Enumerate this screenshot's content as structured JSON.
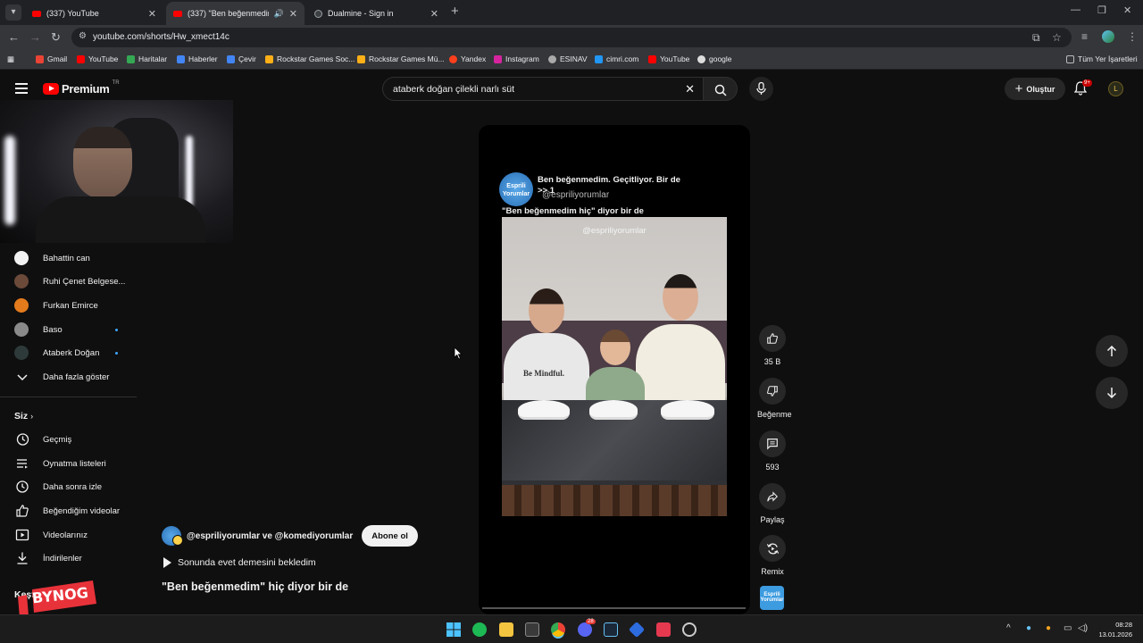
{
  "browser": {
    "tabs": [
      {
        "title": "(337) YouTube"
      },
      {
        "title": "(337) \"Ben beğenmedim\" hiç diyor bir de"
      },
      {
        "title": "Dualmine - Sign in"
      }
    ],
    "url": "youtube.com/shorts/Hw_xmect14c",
    "bookmarks": [
      "Gmail",
      "YouTube",
      "Haritalar",
      "Haberler",
      "Çevir",
      "Rockstar Games Soc...",
      "Rockstar Games Mü...",
      "Yandex",
      "Instagram",
      "ESINAV",
      "cimri.com",
      "YouTube",
      "google"
    ],
    "all_bookmarks": "Tüm Yer İşaretleri"
  },
  "header": {
    "logo": "Premium",
    "region": "TR",
    "search_query": "ataberk doğan çilekli narlı süt",
    "create_label": "Oluştur",
    "notif_count": "9+"
  },
  "sidebar": {
    "subscriptions": [
      {
        "name": "Bahattin can",
        "new": false
      },
      {
        "name": "Ruhi Çenet Belgese...",
        "new": false
      },
      {
        "name": "Furkan Emirce",
        "new": false
      },
      {
        "name": "Baso",
        "new": true
      },
      {
        "name": "Ataberk Doğan",
        "new": true
      }
    ],
    "show_more": "Daha fazla göster",
    "you_heading": "Siz",
    "you_items": [
      {
        "label": "Geçmiş",
        "icon": "history-icon"
      },
      {
        "label": "Oynatma listeleri",
        "icon": "playlist-icon"
      },
      {
        "label": "Daha sonra izle",
        "icon": "clock-icon"
      },
      {
        "label": "Beğendiğim videolar",
        "icon": "thumbs-up-icon"
      },
      {
        "label": "Videolarınız",
        "icon": "video-icon"
      },
      {
        "label": "İndirilenler",
        "icon": "download-icon"
      }
    ],
    "explore_heading": "Keşfet",
    "overlay_logo": "BYNOG"
  },
  "short": {
    "overlay_title": "Ben beğenmedim. Geçitliyor. Bir de >> 1",
    "overlay_handle": "@espriliyorumlar",
    "overlay_quote": "\"Ben beğenmedim hiç\" diyor bir de",
    "watermark": "@espriliyorumlar",
    "shirt_text": "Be Mindful.",
    "avatar_text": "Esprili Yorumlar",
    "progress": 0.0
  },
  "actions": {
    "like_count": "35 B",
    "dislike_label": "Beğenme",
    "comments_count": "593",
    "share_label": "Paylaş",
    "remix_label": "Remix"
  },
  "channel": {
    "names": "@espriliyorumlar ve @komediyorumlar",
    "subscribe_label": "Abone ol",
    "music": "Sonunda evet demesini bekledim",
    "title": "\"Ben beğenmedim\" hiç diyor bir de"
  },
  "taskbar": {
    "time": "08:28",
    "date": "13.01.2026",
    "discord_badge": "28"
  },
  "colors": {
    "background": "#0f0f0f",
    "accent_red": "#ff0000",
    "link_blue": "#3ea6ff"
  }
}
